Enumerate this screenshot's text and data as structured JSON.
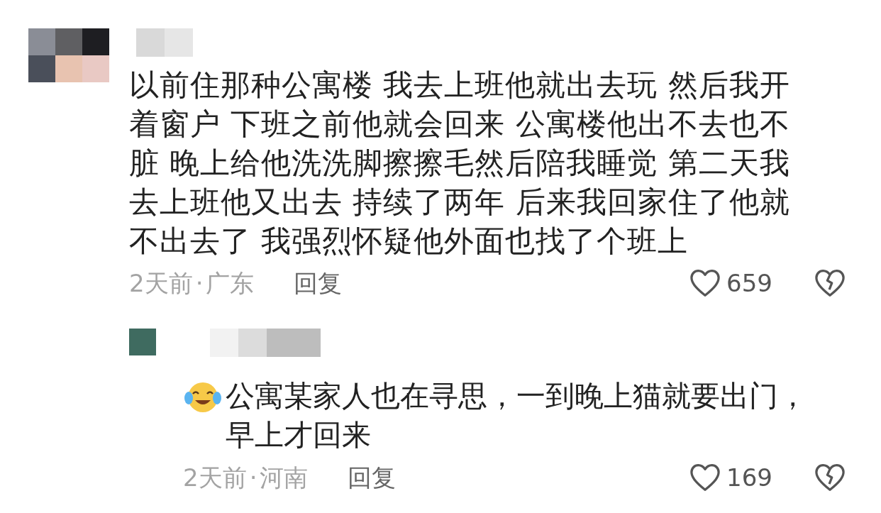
{
  "comments": [
    {
      "text": "以前住那种公寓楼 我去上班他就出去玩 然后我开着窗户 下班之前他就会回来 公寓楼他出不去也不脏 晚上给他洗洗脚擦擦毛然后陪我睡觉 第二天我去上班他又出去 持续了两年 后来我回家住了他就不出去了 我强烈怀疑他外面也找了个班上",
      "time": "2天前",
      "separator": "·",
      "location": "广东",
      "reply": "回复",
      "likes": "659",
      "liked": false,
      "replies": [
        {
          "text": "公寓某家人也在寻思，一到晚上猫就要出门，早上才回来",
          "time": "2天前",
          "separator": "·",
          "location": "河南",
          "reply": "回复",
          "likes": "169",
          "liked": false
        }
      ]
    }
  ]
}
